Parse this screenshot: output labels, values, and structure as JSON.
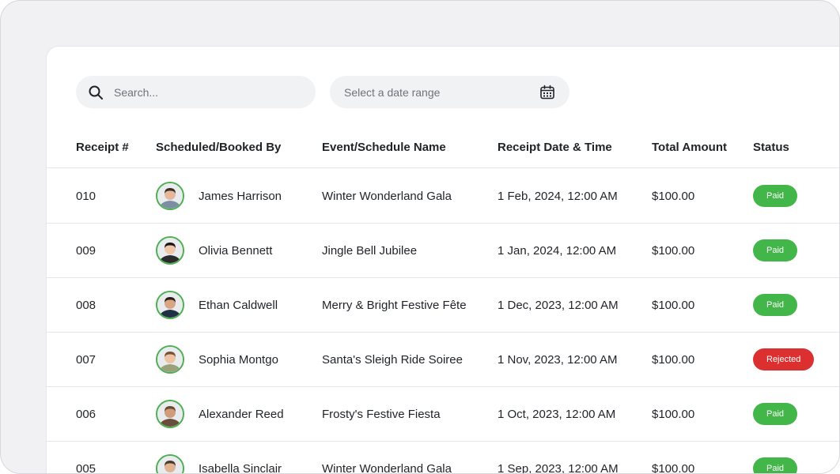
{
  "search": {
    "placeholder": "Search..."
  },
  "date_range": {
    "placeholder": "Select a date range"
  },
  "columns": {
    "receipt": "Receipt #",
    "booked_by": "Scheduled/Booked By",
    "event": "Event/Schedule Name",
    "date": "Receipt Date & Time",
    "amount": "Total Amount",
    "status": "Status"
  },
  "status_colors": {
    "Paid": "#43b649",
    "Rejected": "#dc2f2f"
  },
  "rows": [
    {
      "receipt": "010",
      "name": "James Harrison",
      "event": "Winter Wonderland Gala",
      "date": "1 Feb, 2024, 12:00 AM",
      "amount": "$100.00",
      "status": "Paid",
      "hair": "#3c2d22",
      "skin": "#e4b899",
      "shirt": "#7c8ea3"
    },
    {
      "receipt": "009",
      "name": "Olivia Bennett",
      "event": "Jingle Bell Jubilee",
      "date": "1 Jan, 2024, 12:00 AM",
      "amount": "$100.00",
      "status": "Paid",
      "hair": "#1c1411",
      "skin": "#edc6ab",
      "shirt": "#2b2b2b"
    },
    {
      "receipt": "008",
      "name": "Ethan Caldwell",
      "event": "Merry & Bright Festive Fête",
      "date": "1 Dec, 2023, 12:00 AM",
      "amount": "$100.00",
      "status": "Paid",
      "hair": "#2a1d15",
      "skin": "#d9a585",
      "shirt": "#1f3142"
    },
    {
      "receipt": "007",
      "name": "Sophia Montgo",
      "event": "Santa's Sleigh Ride Soiree",
      "date": "1 Nov, 2023, 12:00 AM",
      "amount": "$100.00",
      "status": "Rejected",
      "hair": "#7a5034",
      "skin": "#ecc4a4",
      "shirt": "#9aa07a"
    },
    {
      "receipt": "006",
      "name": "Alexander Reed",
      "event": "Frosty's Festive Fiesta",
      "date": "1 Oct, 2023, 12:00 AM",
      "amount": "$100.00",
      "status": "Paid",
      "hair": "#6b4a33",
      "skin": "#cf9c7c",
      "shirt": "#6a4e3b"
    },
    {
      "receipt": "005",
      "name": "Isabella Sinclair",
      "event": "Winter Wonderland Gala",
      "date": "1 Sep, 2023, 12:00 AM",
      "amount": "$100.00",
      "status": "Paid",
      "hair": "#4a3a2c",
      "skin": "#e0b393",
      "shirt": "#5f6e7e"
    }
  ]
}
